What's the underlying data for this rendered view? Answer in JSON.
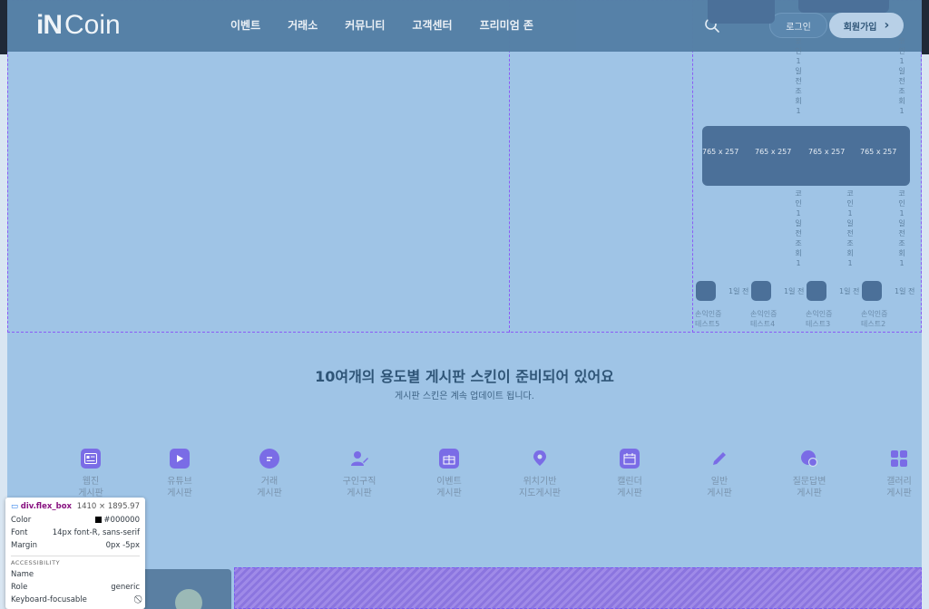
{
  "header": {
    "logo_part1": "iN",
    "logo_part2": "Coin",
    "nav": [
      "이벤트",
      "거래소",
      "커뮤니티",
      "고객센터",
      "프리미엄 존"
    ],
    "login_label": "로그인",
    "join_label": "회원가입",
    "join_chevron": "›"
  },
  "gallery": {
    "vertical_text_a": "코인 1일전 조회 1",
    "vertical_text_b": "코인 1일전 조회 1",
    "banner_labels": [
      "765 x 257",
      "765 x 257",
      "765 x 257",
      "765 x 257"
    ],
    "day_labels": [
      "1일 전",
      "1일 전",
      "1일 전",
      "1일 전"
    ],
    "captions": [
      [
        "손익인증",
        "테스트5"
      ],
      [
        "손익인증",
        "테스트4"
      ],
      [
        "손익인증",
        "테스트3"
      ],
      [
        "손익인증",
        "테스트2"
      ]
    ]
  },
  "section": {
    "title": "10여개의 용도별 게시판 스킨이 준비되어 있어요",
    "subtitle": "게시판 스킨은 계속 업데이트 됩니다."
  },
  "categories": [
    {
      "line1": "웹진",
      "line2": "게시판",
      "icon": "webzine-icon"
    },
    {
      "line1": "유튜브",
      "line2": "게시판",
      "icon": "youtube-icon"
    },
    {
      "line1": "거래",
      "line2": "게시판",
      "icon": "chat-icon"
    },
    {
      "line1": "구인구직",
      "line2": "게시판",
      "icon": "user-edit-icon"
    },
    {
      "line1": "이벤트",
      "line2": "게시판",
      "icon": "gift-icon"
    },
    {
      "line1": "위치기반",
      "line2": "지도게시판",
      "icon": "map-pin-icon"
    },
    {
      "line1": "캘린더",
      "line2": "게시판",
      "icon": "calendar-icon"
    },
    {
      "line1": "일반",
      "line2": "게시판",
      "icon": "pencil-icon"
    },
    {
      "line1": "질문답변",
      "line2": "게시판",
      "icon": "question-icon"
    },
    {
      "line1": "갤러리",
      "line2": "게시판",
      "icon": "grid-icon"
    }
  ],
  "devtools_tooltip": {
    "selector": "div.flex_box",
    "dimensions": "1410 × 1895.97",
    "color_label": "Color",
    "color_value": "#000000",
    "font_label": "Font",
    "font_value": "14px font-R, sans-serif",
    "margin_label": "Margin",
    "margin_value": "0px -5px",
    "accessibility_label": "ACCESSIBILITY",
    "name_label": "Name",
    "name_value": "",
    "role_label": "Role",
    "role_value": "generic",
    "focusable_label": "Keyboard-focusable",
    "focusable_value": "⃠"
  },
  "colors": {
    "overlay": "#6fa8dc",
    "header": "#5580a6",
    "accent_purple": "#7a6ce6",
    "title_text": "#2f5577"
  }
}
